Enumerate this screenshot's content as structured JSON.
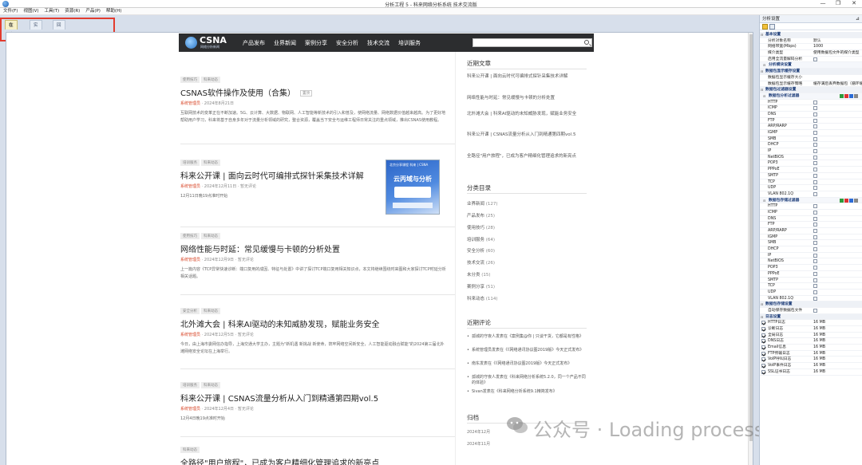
{
  "window": {
    "title": "分析工程 5 - 科来网络分析系统 技术交流版",
    "min": "—",
    "max": "❐",
    "close": "✕"
  },
  "menu": [
    "文件(F)",
    "视图(V)",
    "工具(T)",
    "资源(R)",
    "产品(P)",
    "帮助(H)"
  ],
  "tabs": [
    "在线资源",
    "实时分析",
    "回放分析"
  ],
  "site": {
    "logo": "CSNA",
    "logo_sub": "网络分析新闻",
    "nav": [
      "产品发布",
      "业界新闻",
      "案例分享",
      "安全分析",
      "技术交流",
      "培训服务"
    ],
    "search_placeholder": ""
  },
  "articles": [
    {
      "tags": [
        "使用技巧",
        "科来动态"
      ],
      "title": "CSNAS软件操作及使用（合集）",
      "badge": "置顶",
      "author": "系统管理员",
      "date": " · 2024年8月21日",
      "excerpt": "互联网技术的变革正在不断加速。5G、云计算、大数据、物联网、人工智能等新技术的引入和普及，使网络流量、网络数据价值越来越高。为了更好地帮助用户学习，科来将基于自身多年对于流量分析领域的研究，整合资源，覆盖当下安全与运维工程师日常关注的重点领域，推出CSNAS使用教程。"
    },
    {
      "tags": [
        "培训服务",
        "科来动态"
      ],
      "title": "科来公开课 | 面向云时代可编排式探针采集技术详解",
      "author": "系统管理员",
      "date": " · 2024年12月11日 · 暂无评论",
      "excerpt": "12月11日晚19点准时开始",
      "thumb": {
        "line1": "北京分享课程 科来 | CSNA",
        "line2": "云丙域与分析"
      }
    },
    {
      "tags": [
        "使用技巧",
        "科来动态"
      ],
      "title": "网络性能与时延：常见缓慢与卡顿的分析处置",
      "author": "系统管理员",
      "date": " · 2024年12月9日 · 暂无评论",
      "excerpt": "上一篇内容《TCP异常快速诊断：端口复用的成因、特征与处置》中讲了探讨TCP端口复用相关知识点，本文将继续围绕时来图和大家探讨TCP时延分析相关话题。"
    },
    {
      "tags": [
        "安全分析",
        "科来动态"
      ],
      "title": "北外滩大会 | 科来AI驱动的未知威胁发现，赋能业务安全",
      "author": "系统管理员",
      "date": " · 2024年12月5日 · 暂无评论",
      "excerpt": "今日，由上海市委网信办指导，上海交通大学主办，主题为\"新机遇 新挑战 新使命，筑牢网络空间新安全，人工智能驱动融合赋能\"的2024第三届北外滩网络安全论坛在上海举行。"
    },
    {
      "tags": [
        "培训服务",
        "科来动态"
      ],
      "title": "科来公开课 | CSNAS流量分析从入门到精通第四期vol.5",
      "author": "系统管理员",
      "date": " · 2024年12月4日 · 暂无评论",
      "excerpt": "12月4日晚19点准时开始"
    },
    {
      "tags": [
        "科来动态"
      ],
      "title": "全路径\"用户旅程\"，已成为客户精细化管理追求的新亮点",
      "author": "",
      "date": "",
      "excerpt": ""
    }
  ],
  "sidebar": {
    "recent_title": "近期文章",
    "recent": [
      "科来公开课 | 面向云时代可编排式探针采集技术详解",
      "网络性能与时延：常见缓慢与卡顿的分析处置",
      "北外滩大会 | 科来AI驱动的未知威胁发现，赋能业务安全",
      "科来公开课 | CSNAS流量分析从入门到精通第四期vol.5",
      "全路径\"用户旅程\"，已成为客户精细化管理追求的新亮点"
    ],
    "categories_title": "分类目录",
    "categories": [
      {
        "name": "业界新闻",
        "count": "(127)"
      },
      {
        "name": "产品发布",
        "count": "(25)"
      },
      {
        "name": "使用技巧",
        "count": "(28)"
      },
      {
        "name": "培训服务",
        "count": "(64)"
      },
      {
        "name": "安全分析",
        "count": "(60)"
      },
      {
        "name": "技术交流",
        "count": "(26)"
      },
      {
        "name": "未分类",
        "count": "(15)"
      },
      {
        "name": "案例分享",
        "count": "(51)"
      },
      {
        "name": "科来动态",
        "count": "(114)"
      }
    ],
    "comments_title": "近期评论",
    "comments": [
      "孤城的守夜人发表在《案例集@你 | 只谈干货，它都是有性格》",
      "系统管理员发表在《《网络通讯协议图2019版》今天正式发布》",
      "南东发表在《《网络通讯协议图2019版》今天正式发布》",
      "孤城的守夜人发表在《科来网络分析系统5.2.0，同一个产品不同的体验》",
      "Sivan发表在《科来网络分析系统9.1精简发布》"
    ],
    "archive_title": "归档",
    "archive": [
      "2024年12月",
      "2024年11月"
    ]
  },
  "watermark": "公众号 · Loading process",
  "panel": {
    "title": "分析设置",
    "rows": [
      {
        "type": "sec",
        "label": "基本设置"
      },
      {
        "type": "kv",
        "label": "分析对象名称",
        "value": "默认"
      },
      {
        "type": "kv",
        "label": "网络带宽(Mbps)",
        "value": "1000"
      },
      {
        "type": "kv",
        "label": "媒介类型",
        "value": "使用数据包文件的媒介类型"
      },
      {
        "type": "chk",
        "label": "启用全流量解码分析",
        "checked": false
      },
      {
        "type": "sub",
        "label": "分析模块设置"
      },
      {
        "type": "sec",
        "label": "数据包显示缓存设置"
      },
      {
        "type": "kv",
        "label": "数据包显示缓存大小",
        "value": ""
      },
      {
        "type": "kv",
        "label": "数据包显示缓存策略",
        "value": "缓存满后丢弃数据包（循环缓存）"
      },
      {
        "type": "sec",
        "label": "数据包过滤器设置"
      },
      {
        "type": "sub",
        "label": "数据包分析过滤器"
      },
      {
        "type": "chk",
        "label": "HTTP",
        "checked": false
      },
      {
        "type": "chk",
        "label": "ICMP",
        "checked": false
      },
      {
        "type": "chk",
        "label": "DNS",
        "checked": false
      },
      {
        "type": "chk",
        "label": "FTP",
        "checked": false
      },
      {
        "type": "chk",
        "label": "ARP/RARP",
        "checked": false
      },
      {
        "type": "chk",
        "label": "IGMP",
        "checked": false
      },
      {
        "type": "chk",
        "label": "SMB",
        "checked": false
      },
      {
        "type": "chk",
        "label": "DHCP",
        "checked": false
      },
      {
        "type": "chk",
        "label": "IP",
        "checked": false
      },
      {
        "type": "chk",
        "label": "NetBIOS",
        "checked": false
      },
      {
        "type": "chk",
        "label": "POP3",
        "checked": false
      },
      {
        "type": "chk",
        "label": "PPPoE",
        "checked": false
      },
      {
        "type": "chk",
        "label": "SMTP",
        "checked": false
      },
      {
        "type": "chk",
        "label": "TCP",
        "checked": false
      },
      {
        "type": "chk",
        "label": "UDP",
        "checked": false
      },
      {
        "type": "chk",
        "label": "VLAN 802.1Q",
        "checked": false
      },
      {
        "type": "sub",
        "label": "数据包存储过滤器"
      },
      {
        "type": "chk",
        "label": "HTTP",
        "checked": false
      },
      {
        "type": "chk",
        "label": "ICMP",
        "checked": false
      },
      {
        "type": "chk",
        "label": "DNS",
        "checked": false
      },
      {
        "type": "chk",
        "label": "FTP",
        "checked": false
      },
      {
        "type": "chk",
        "label": "ARP/RARP",
        "checked": false
      },
      {
        "type": "chk",
        "label": "IGMP",
        "checked": false
      },
      {
        "type": "chk",
        "label": "SMB",
        "checked": false
      },
      {
        "type": "chk",
        "label": "DHCP",
        "checked": false
      },
      {
        "type": "chk",
        "label": "IP",
        "checked": false
      },
      {
        "type": "chk",
        "label": "NetBIOS",
        "checked": false
      },
      {
        "type": "chk",
        "label": "POP3",
        "checked": false
      },
      {
        "type": "chk",
        "label": "PPPoE",
        "checked": false
      },
      {
        "type": "chk",
        "label": "SMTP",
        "checked": false
      },
      {
        "type": "chk",
        "label": "TCP",
        "checked": false
      },
      {
        "type": "chk",
        "label": "UDP",
        "checked": false
      },
      {
        "type": "chk",
        "label": "VLAN 802.1Q",
        "checked": false
      },
      {
        "type": "sec",
        "label": "数据包存储设置"
      },
      {
        "type": "chk",
        "label": "自动保存数据包文件",
        "checked": false
      },
      {
        "type": "sec",
        "label": "日志设置"
      },
      {
        "type": "log",
        "label": "HTTP日志",
        "value": "16 MB",
        "checked": true
      },
      {
        "type": "log",
        "label": "诊断日志",
        "value": "16 MB",
        "checked": true
      },
      {
        "type": "log",
        "label": "全局日志",
        "value": "16 MB",
        "checked": true
      },
      {
        "type": "log",
        "label": "DNS日志",
        "value": "16 MB",
        "checked": true
      },
      {
        "type": "log",
        "label": "Email信息",
        "value": "16 MB",
        "checked": true
      },
      {
        "type": "log",
        "label": "FTP传输日志",
        "value": "16 MB",
        "checked": true
      },
      {
        "type": "log",
        "label": "VoIP呼叫日志",
        "value": "16 MB",
        "checked": true
      },
      {
        "type": "log",
        "label": "VoIP事件日志",
        "value": "16 MB",
        "checked": true
      },
      {
        "type": "log",
        "label": "SSL证书日志",
        "value": "16 MB",
        "checked": true
      }
    ]
  },
  "colors": {
    "highlight": "#e23b2e",
    "author": "#d9492b",
    "nav_bg": "#2c2d2f",
    "workspace_bg": "#d7dfeb"
  }
}
